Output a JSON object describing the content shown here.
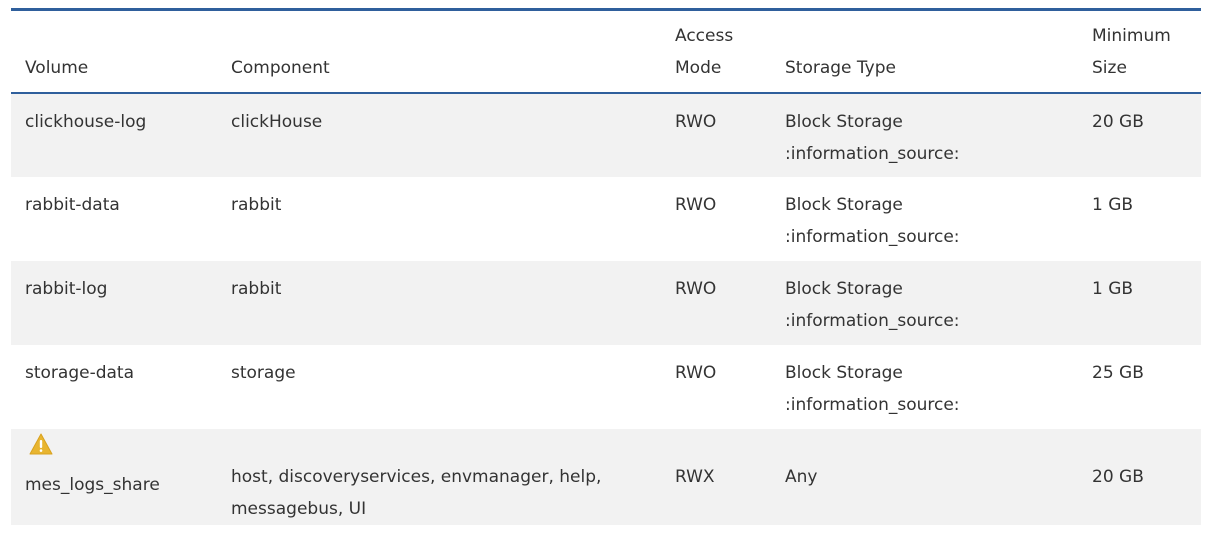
{
  "table": {
    "headers": {
      "volume": "Volume",
      "component": "Component",
      "access_mode_line1": "Access",
      "access_mode_line2": "Mode",
      "storage_type": "Storage Type",
      "minimum_size": "Minimum Size"
    },
    "rows": [
      {
        "volume": "clickhouse-log",
        "component": "clickHouse",
        "access_mode": "RWO",
        "storage_type": "Block Storage",
        "storage_note": ":information_source:",
        "minimum_size": "20 GB"
      },
      {
        "volume": "rabbit-data",
        "component": "rabbit",
        "access_mode": "RWO",
        "storage_type": "Block Storage",
        "storage_note": ":information_source:",
        "minimum_size": "1 GB"
      },
      {
        "volume": "rabbit-log",
        "component": "rabbit",
        "access_mode": "RWO",
        "storage_type": "Block Storage",
        "storage_note": ":information_source:",
        "minimum_size": "1 GB"
      },
      {
        "volume": "storage-data",
        "component": "storage",
        "access_mode": "RWO",
        "storage_type": "Block Storage",
        "storage_note": ":information_source:",
        "minimum_size": "25 GB"
      },
      {
        "icon": "warning-icon",
        "volume": "mes_logs_share",
        "component_line1": "host, discoveryservices, envmanager, help,",
        "component_line2": "messagebus, UI",
        "access_mode": "RWX",
        "storage_type": "Any",
        "minimum_size": "20 GB"
      }
    ]
  },
  "colors": {
    "rule": "#2f5f9c",
    "stripe": "#f2f2f2",
    "warning": "#e8b530"
  }
}
